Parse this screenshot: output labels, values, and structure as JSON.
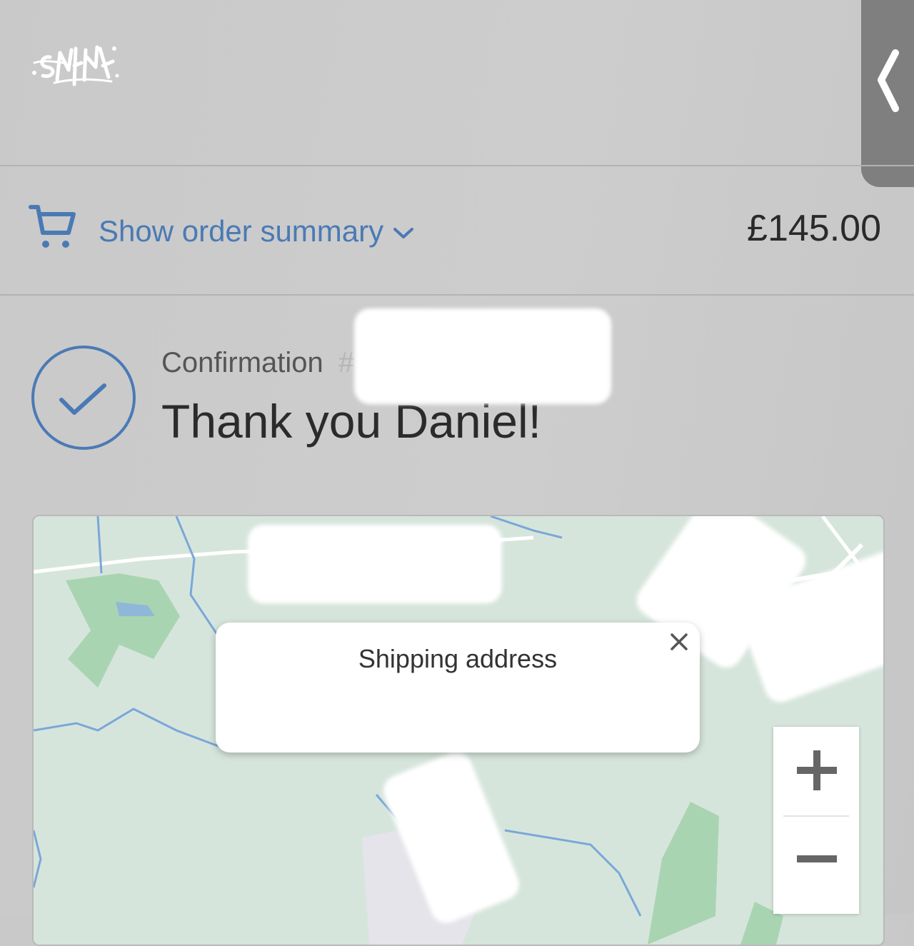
{
  "header": {
    "logo_icon": "graffiti-logo-icon",
    "side_tab_icon": "chevron-left-icon"
  },
  "order_summary": {
    "toggle_label": "Show order summary",
    "total": "£145.00",
    "icons": [
      "cart-icon",
      "chevron-down-icon"
    ]
  },
  "confirmation": {
    "label": "Confirmation",
    "number_prefix": "#",
    "thanks": "Thank you Daniel!",
    "icon": "check-circle-icon"
  },
  "map": {
    "info_window": {
      "title": "Shipping address",
      "close_icon": "close-icon"
    },
    "zoom": {
      "in_label": "+",
      "out_label": "−"
    }
  },
  "colors": {
    "accent": "#4a7ab5",
    "background": "#cbcbcb",
    "map": "#d6e5dc"
  }
}
